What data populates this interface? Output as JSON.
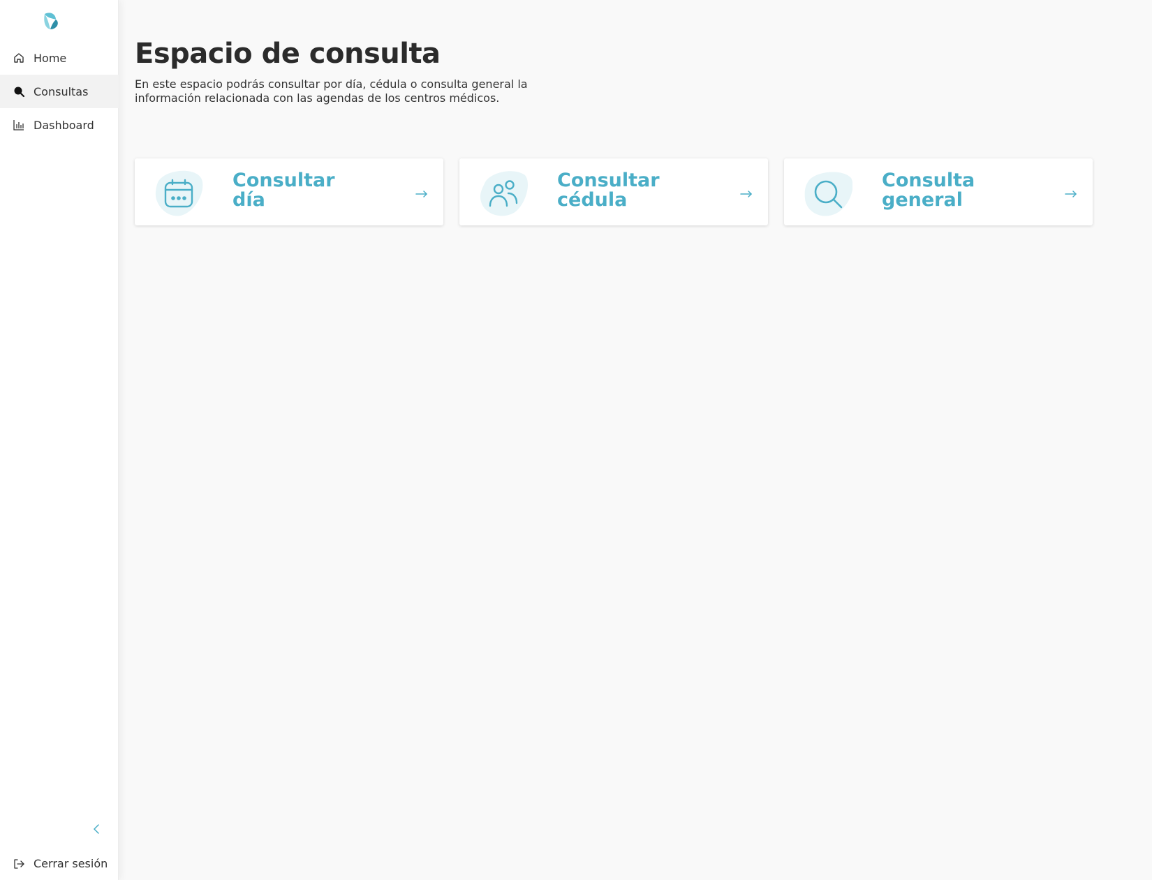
{
  "sidebar": {
    "logo": "brand-logo",
    "items": [
      {
        "label": "Home",
        "icon": "home-icon",
        "active": false
      },
      {
        "label": "Consultas",
        "icon": "search-icon",
        "active": true
      },
      {
        "label": "Dashboard",
        "icon": "bar-chart-icon",
        "active": false
      }
    ],
    "collapse_icon": "chevron-left-icon",
    "logout_label": "Cerrar sesión",
    "logout_icon": "logout-icon"
  },
  "main": {
    "title": "Espacio de consulta",
    "description": "En este espacio podrás consultar por día, cédula o consulta general la información relacionada con las agendas de los centros médicos.",
    "cards": [
      {
        "title": "Consultar\ndía",
        "icon": "calendar-icon"
      },
      {
        "title": "Consultar\ncédula",
        "icon": "users-icon"
      },
      {
        "title": "Consulta\ngeneral",
        "icon": "search-icon"
      }
    ]
  },
  "colors": {
    "accent": "#4aaec7",
    "blob": "#e8f5f8",
    "text": "#2b2b2b"
  }
}
